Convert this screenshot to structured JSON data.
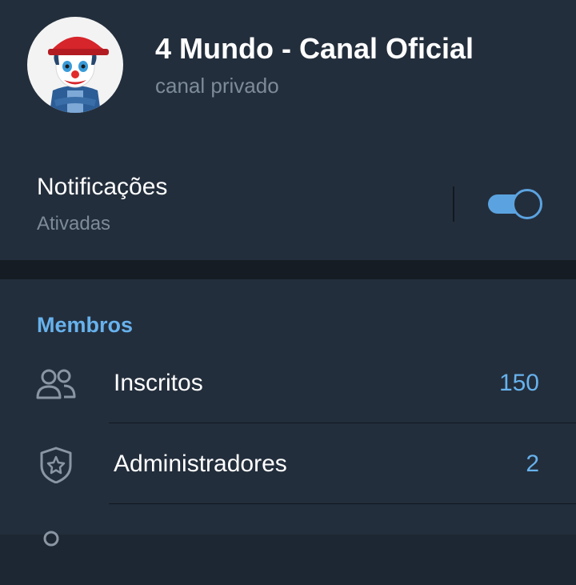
{
  "header": {
    "title": "4 Mundo - Canal Oficial",
    "subtitle": "canal privado",
    "avatar_icon": "clown-avatar-icon"
  },
  "notifications": {
    "label": "Notificações",
    "status": "Ativadas",
    "enabled": true,
    "accent_color": "#5ba3e0"
  },
  "members": {
    "section_title": "Membros",
    "rows": [
      {
        "label": "Inscritos",
        "count": "150",
        "icon": "users-icon"
      },
      {
        "label": "Administradores",
        "count": "2",
        "icon": "admin-shield-icon"
      }
    ],
    "partial_row_icon": "person-icon"
  },
  "colors": {
    "background": "#232e3c",
    "separator": "#151c24",
    "accent": "#67b2ed",
    "secondary_text": "#7d8b99"
  }
}
